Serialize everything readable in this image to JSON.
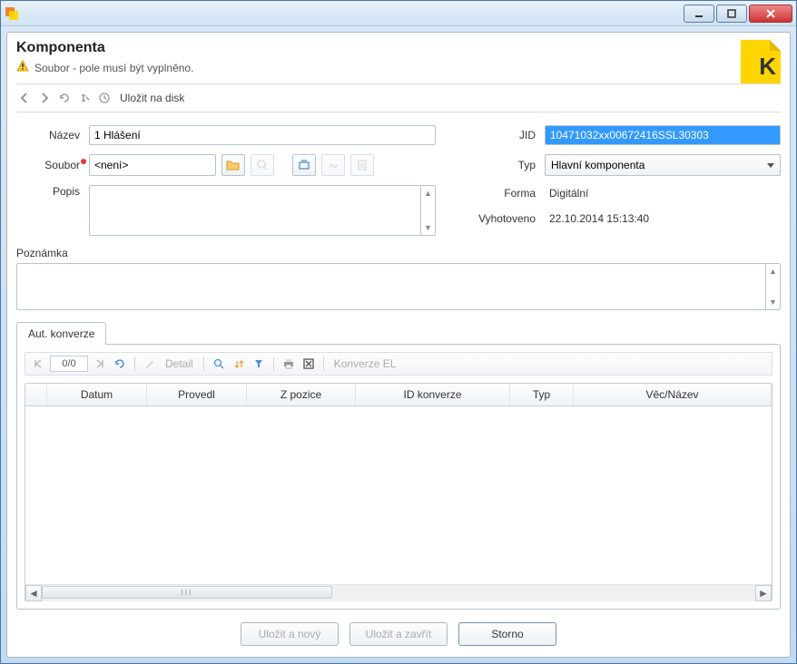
{
  "window": {
    "app_icon": "component-icon"
  },
  "header": {
    "title": "Komponenta",
    "warning": "Soubor - pole musí být vyplněno.",
    "badge_letter": "K"
  },
  "toolbar": {
    "save_to_disk": "Uložit na disk"
  },
  "form": {
    "nazev_label": "Název",
    "nazev_value": "1 Hlášení",
    "soubor_label": "Soubor",
    "soubor_value": "<není>",
    "popis_label": "Popis",
    "popis_value": "",
    "jid_label": "JID",
    "jid_value": "10471032xx00672416SSL30303",
    "typ_label": "Typ",
    "typ_value": "Hlavní komponenta",
    "forma_label": "Forma",
    "forma_value": "Digitální",
    "vyhotoveno_label": "Vyhotoveno",
    "vyhotoveno_value": "22.10.2014 15:13:40"
  },
  "note": {
    "label": "Poznámka",
    "value": ""
  },
  "tabs": {
    "aut_konverze": "Aut. konverze"
  },
  "grid_toolbar": {
    "page": "0/0",
    "detail": "Detail",
    "konverze_el": "Konverze EL"
  },
  "grid": {
    "columns": [
      "Datum",
      "Provedl",
      "Z pozice",
      "ID konverze",
      "Typ",
      "Věc/Název"
    ],
    "rows": []
  },
  "footer": {
    "save_new": "Uložit a nový",
    "save_close": "Uložit a zavřít",
    "cancel": "Storno"
  }
}
